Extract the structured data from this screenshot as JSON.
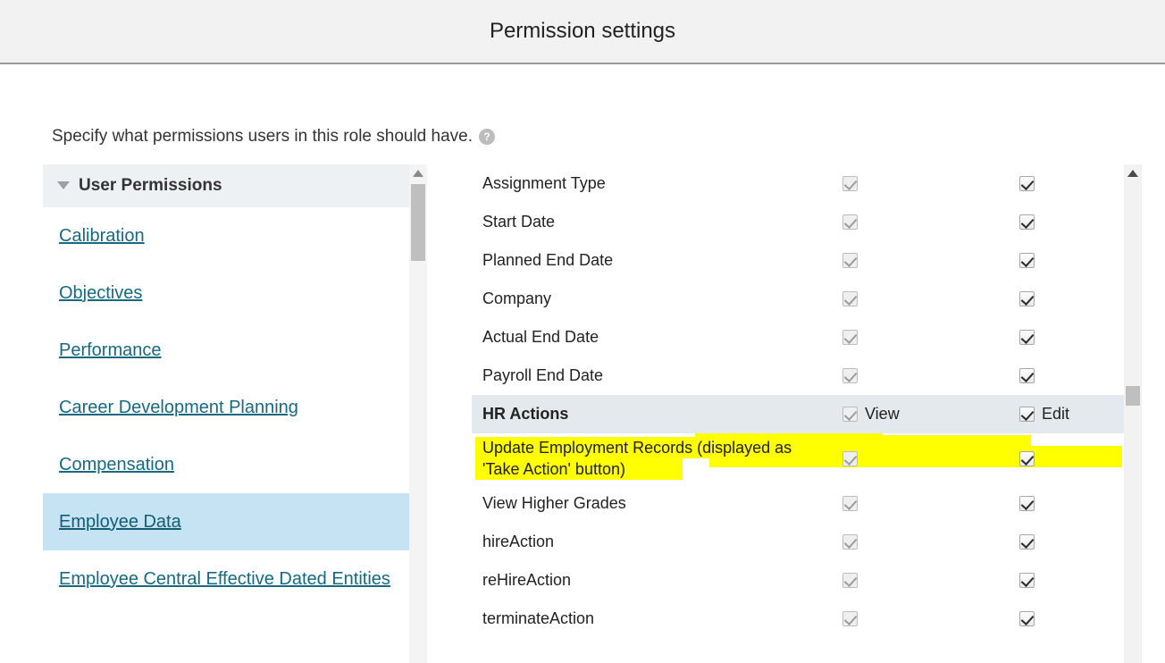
{
  "window": {
    "title": "Permission settings"
  },
  "description": {
    "text": "Specify what permissions users in this role should have.",
    "help_icon": "help-circle-icon",
    "help_glyph": "?"
  },
  "sidebar": {
    "header": {
      "label": "User Permissions",
      "disclosure_icon": "triangle-down-icon",
      "expanded": true
    },
    "items": [
      {
        "label": "Calibration",
        "selected": false
      },
      {
        "label": "Objectives",
        "selected": false
      },
      {
        "label": "Performance",
        "selected": false
      },
      {
        "label": "Career Development Planning",
        "selected": false
      },
      {
        "label": "Compensation",
        "selected": false
      },
      {
        "label": "Employee Data",
        "selected": true
      },
      {
        "label": "Employee Central Effective Dated Entities",
        "selected": false
      }
    ],
    "scrollbar": {
      "up_arrow_icon": "scroll-up-arrow-icon",
      "thumb": "scroll-thumb"
    }
  },
  "content": {
    "columns": {
      "view_label": "View",
      "edit_label": "Edit"
    },
    "rows": [
      {
        "label": "Assignment Type",
        "type": "field",
        "view": true,
        "view_disabled": true,
        "edit": true,
        "highlighted": false
      },
      {
        "label": "Start Date",
        "type": "field",
        "view": true,
        "view_disabled": true,
        "edit": true,
        "highlighted": false
      },
      {
        "label": "Planned End Date",
        "type": "field",
        "view": true,
        "view_disabled": true,
        "edit": true,
        "highlighted": false
      },
      {
        "label": "Company",
        "type": "field",
        "view": true,
        "view_disabled": true,
        "edit": true,
        "highlighted": false
      },
      {
        "label": "Actual End Date",
        "type": "field",
        "view": true,
        "view_disabled": true,
        "edit": true,
        "highlighted": false
      },
      {
        "label": "Payroll End Date",
        "type": "field",
        "view": true,
        "view_disabled": true,
        "edit": true,
        "highlighted": false
      },
      {
        "label": "HR Actions",
        "type": "group",
        "view": true,
        "view_disabled": true,
        "edit": true,
        "highlighted": false,
        "show_captions": true
      },
      {
        "label": "Update Employment Records (displayed as 'Take Action' button)",
        "type": "field",
        "view": true,
        "view_disabled": true,
        "edit": true,
        "highlighted": true,
        "tall": true
      },
      {
        "label": "View Higher Grades",
        "type": "field",
        "view": true,
        "view_disabled": true,
        "edit": true,
        "highlighted": false
      },
      {
        "label": "hireAction",
        "type": "field",
        "view": true,
        "view_disabled": true,
        "edit": true,
        "highlighted": false
      },
      {
        "label": "reHireAction",
        "type": "field",
        "view": true,
        "view_disabled": true,
        "edit": true,
        "highlighted": false
      },
      {
        "label": "terminateAction",
        "type": "field",
        "view": true,
        "view_disabled": true,
        "edit": true,
        "highlighted": false
      }
    ],
    "scrollbar": {
      "up_arrow_icon": "scroll-up-arrow-icon",
      "thumb": "scroll-thumb"
    }
  },
  "colors": {
    "header_bg": "#f2f2f2",
    "group_row_bg": "#e4e9ee",
    "selected_item_bg": "#c5e3f2",
    "link": "#16697f",
    "highlight_marker": "#ffff00"
  }
}
